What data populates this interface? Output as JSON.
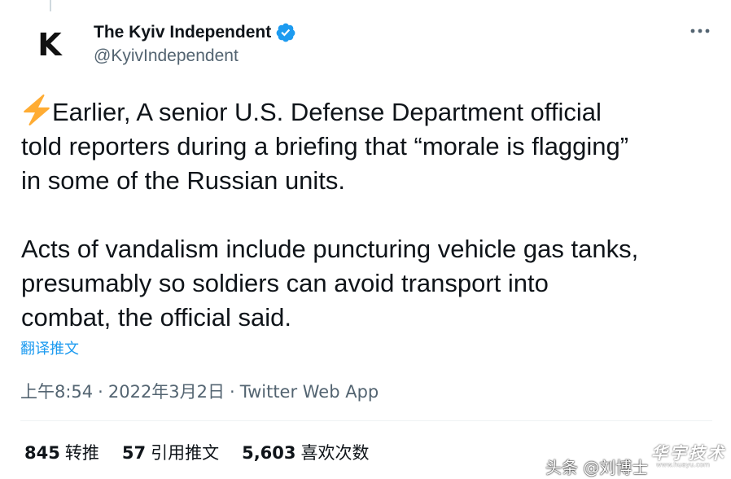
{
  "author": {
    "avatar_letter": "K",
    "display_name": "The Kyiv Independent",
    "handle": "@KyivIndependent",
    "verified": true
  },
  "colors": {
    "accent": "#1d9bf0",
    "text_primary": "#0f1419",
    "text_secondary": "#536471"
  },
  "icons": {
    "verified": "verified-badge-icon",
    "more": "more-horizontal-icon",
    "bolt": "high-voltage-emoji-icon"
  },
  "tweet": {
    "paragraph_1": "Earlier, A senior U.S. Defense Department official\ntold reporters during a briefing that “morale is flagging”\nin some of the Russian units.",
    "paragraph_2": "Acts of vandalism include puncturing vehicle gas tanks,\npresumably so soldiers can avoid transport into\ncombat, the official said.",
    "translate_label": "翻译推文"
  },
  "meta": {
    "time": "上午8:54",
    "separator": "·",
    "date": "2022年3月2日",
    "source": "Twitter Web App"
  },
  "stats": [
    {
      "count": "845",
      "label": "转推"
    },
    {
      "count": "57",
      "label": "引用推文"
    },
    {
      "count": "5,603",
      "label": "喜欢次数"
    }
  ],
  "watermark": {
    "text": "头条 @刘博士",
    "logo": "华宇技术",
    "logo_sub": "www.huayu.com"
  }
}
